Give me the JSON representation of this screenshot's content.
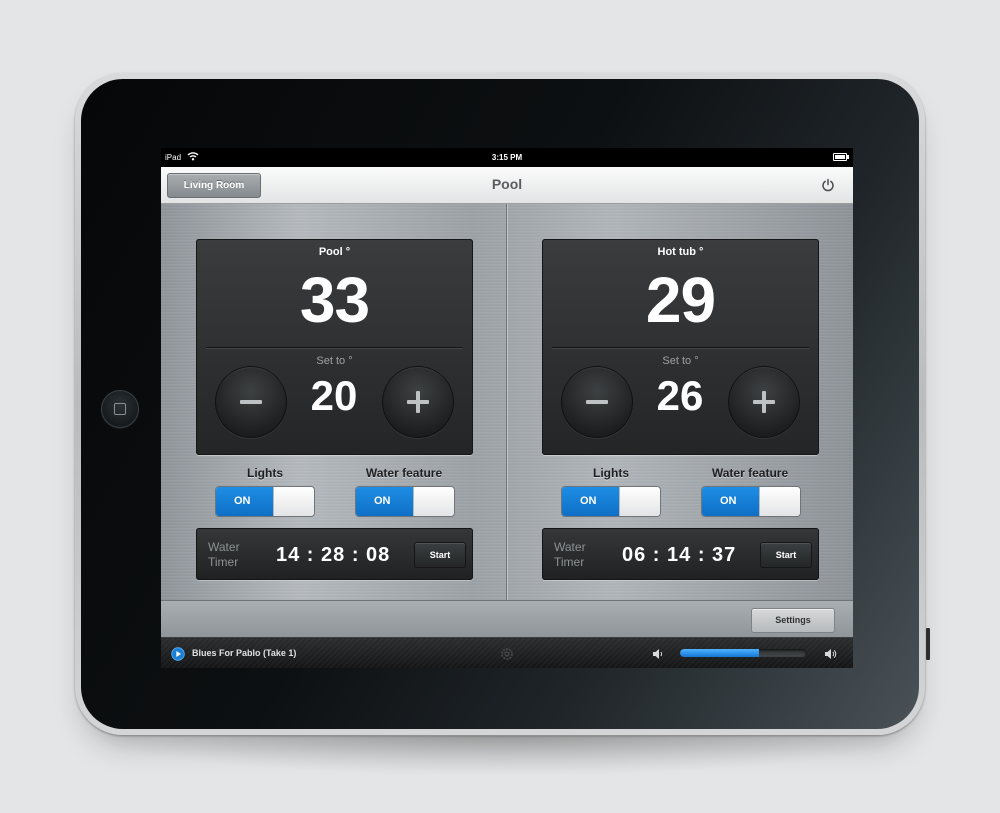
{
  "status_bar": {
    "carrier": "iPad",
    "time": "3:15 PM"
  },
  "nav": {
    "back_label": "Living Room",
    "title": "Pool"
  },
  "panels": [
    {
      "title": "Pool °",
      "current_temp": "33",
      "set_label": "Set to °",
      "set_temp": "20",
      "lights_label": "Lights",
      "lights_state": "ON",
      "water_label": "Water feature",
      "water_state": "ON",
      "timer_label": "Water Timer",
      "timer_value": "14 : 28 : 08",
      "start_label": "Start"
    },
    {
      "title": "Hot tub °",
      "current_temp": "29",
      "set_label": "Set to °",
      "set_temp": "26",
      "lights_label": "Lights",
      "lights_state": "ON",
      "water_label": "Water feature",
      "water_state": "ON",
      "timer_label": "Water Timer",
      "timer_value": "06 : 14 : 37",
      "start_label": "Start"
    }
  ],
  "settings_label": "Settings",
  "player": {
    "track": "Blues For Pablo (Take 1)",
    "volume": 0.63
  },
  "icons": {
    "back": "none",
    "power": "power-icon",
    "minus": "minus-icon",
    "plus": "plus-icon",
    "play": "play-icon",
    "gear": "gear-icon",
    "volume_low": "volume-low-icon",
    "volume_high": "volume-high-icon"
  },
  "colors": {
    "accent": "#1a85dc",
    "card": "#2c2e30",
    "metal": "#a6acb0"
  }
}
